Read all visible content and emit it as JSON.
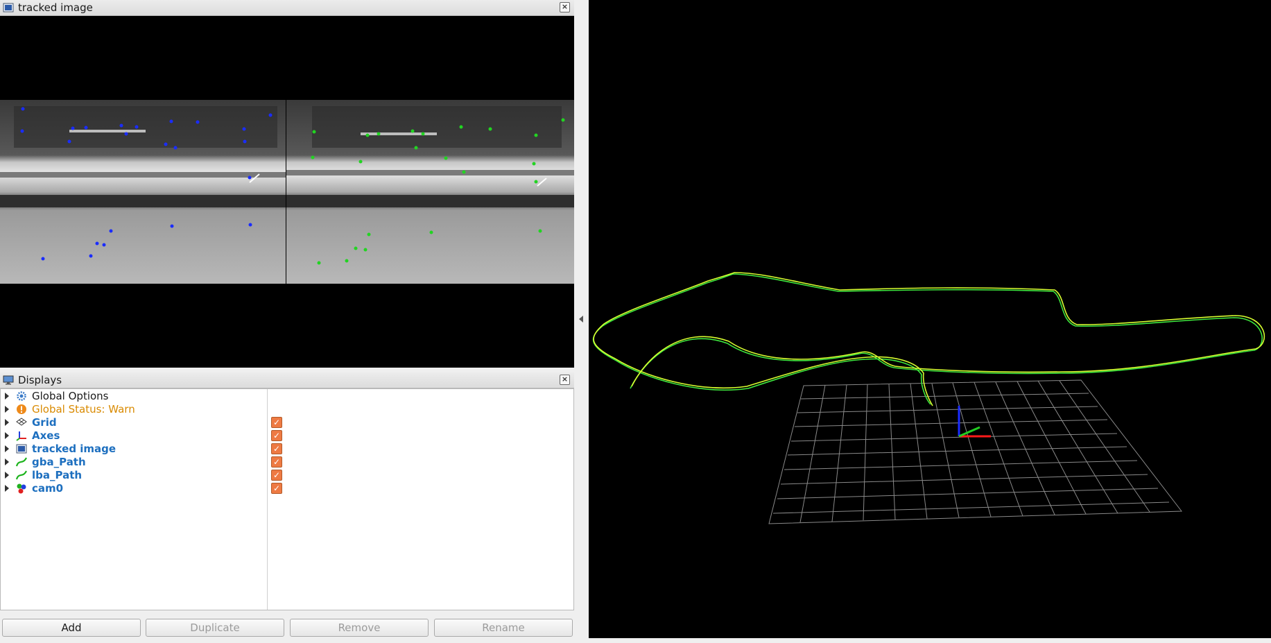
{
  "tracked_panel": {
    "title": "tracked image",
    "close_icon": "close-icon"
  },
  "displays_panel": {
    "title": "Displays",
    "close_icon": "close-icon",
    "items": [
      {
        "label": "Global Options",
        "icon": "gear-icon",
        "style": "normal",
        "checkbox": false
      },
      {
        "label": "Global Status: Warn",
        "icon": "warning-icon",
        "style": "warn",
        "checkbox": false
      },
      {
        "label": "Grid",
        "icon": "grid-icon",
        "style": "blue",
        "checkbox": true
      },
      {
        "label": "Axes",
        "icon": "axes-icon",
        "style": "blue",
        "checkbox": true
      },
      {
        "label": "tracked image",
        "icon": "image-icon",
        "style": "blue",
        "checkbox": true
      },
      {
        "label": "gba_Path",
        "icon": "path-icon",
        "style": "blue",
        "checkbox": true
      },
      {
        "label": "lba_Path",
        "icon": "path-icon",
        "style": "blue",
        "checkbox": true
      },
      {
        "label": "cam0",
        "icon": "markers-icon",
        "style": "blue",
        "checkbox": true
      }
    ]
  },
  "buttons": {
    "add": "Add",
    "duplicate": "Duplicate",
    "remove": "Remove",
    "rename": "Rename"
  },
  "colors": {
    "path_green": "#3ee83e",
    "path_yellow": "#d8ff30",
    "feature_blue": "#1a2cff",
    "feature_green": "#22d422",
    "grid": "#8a8a8a"
  }
}
